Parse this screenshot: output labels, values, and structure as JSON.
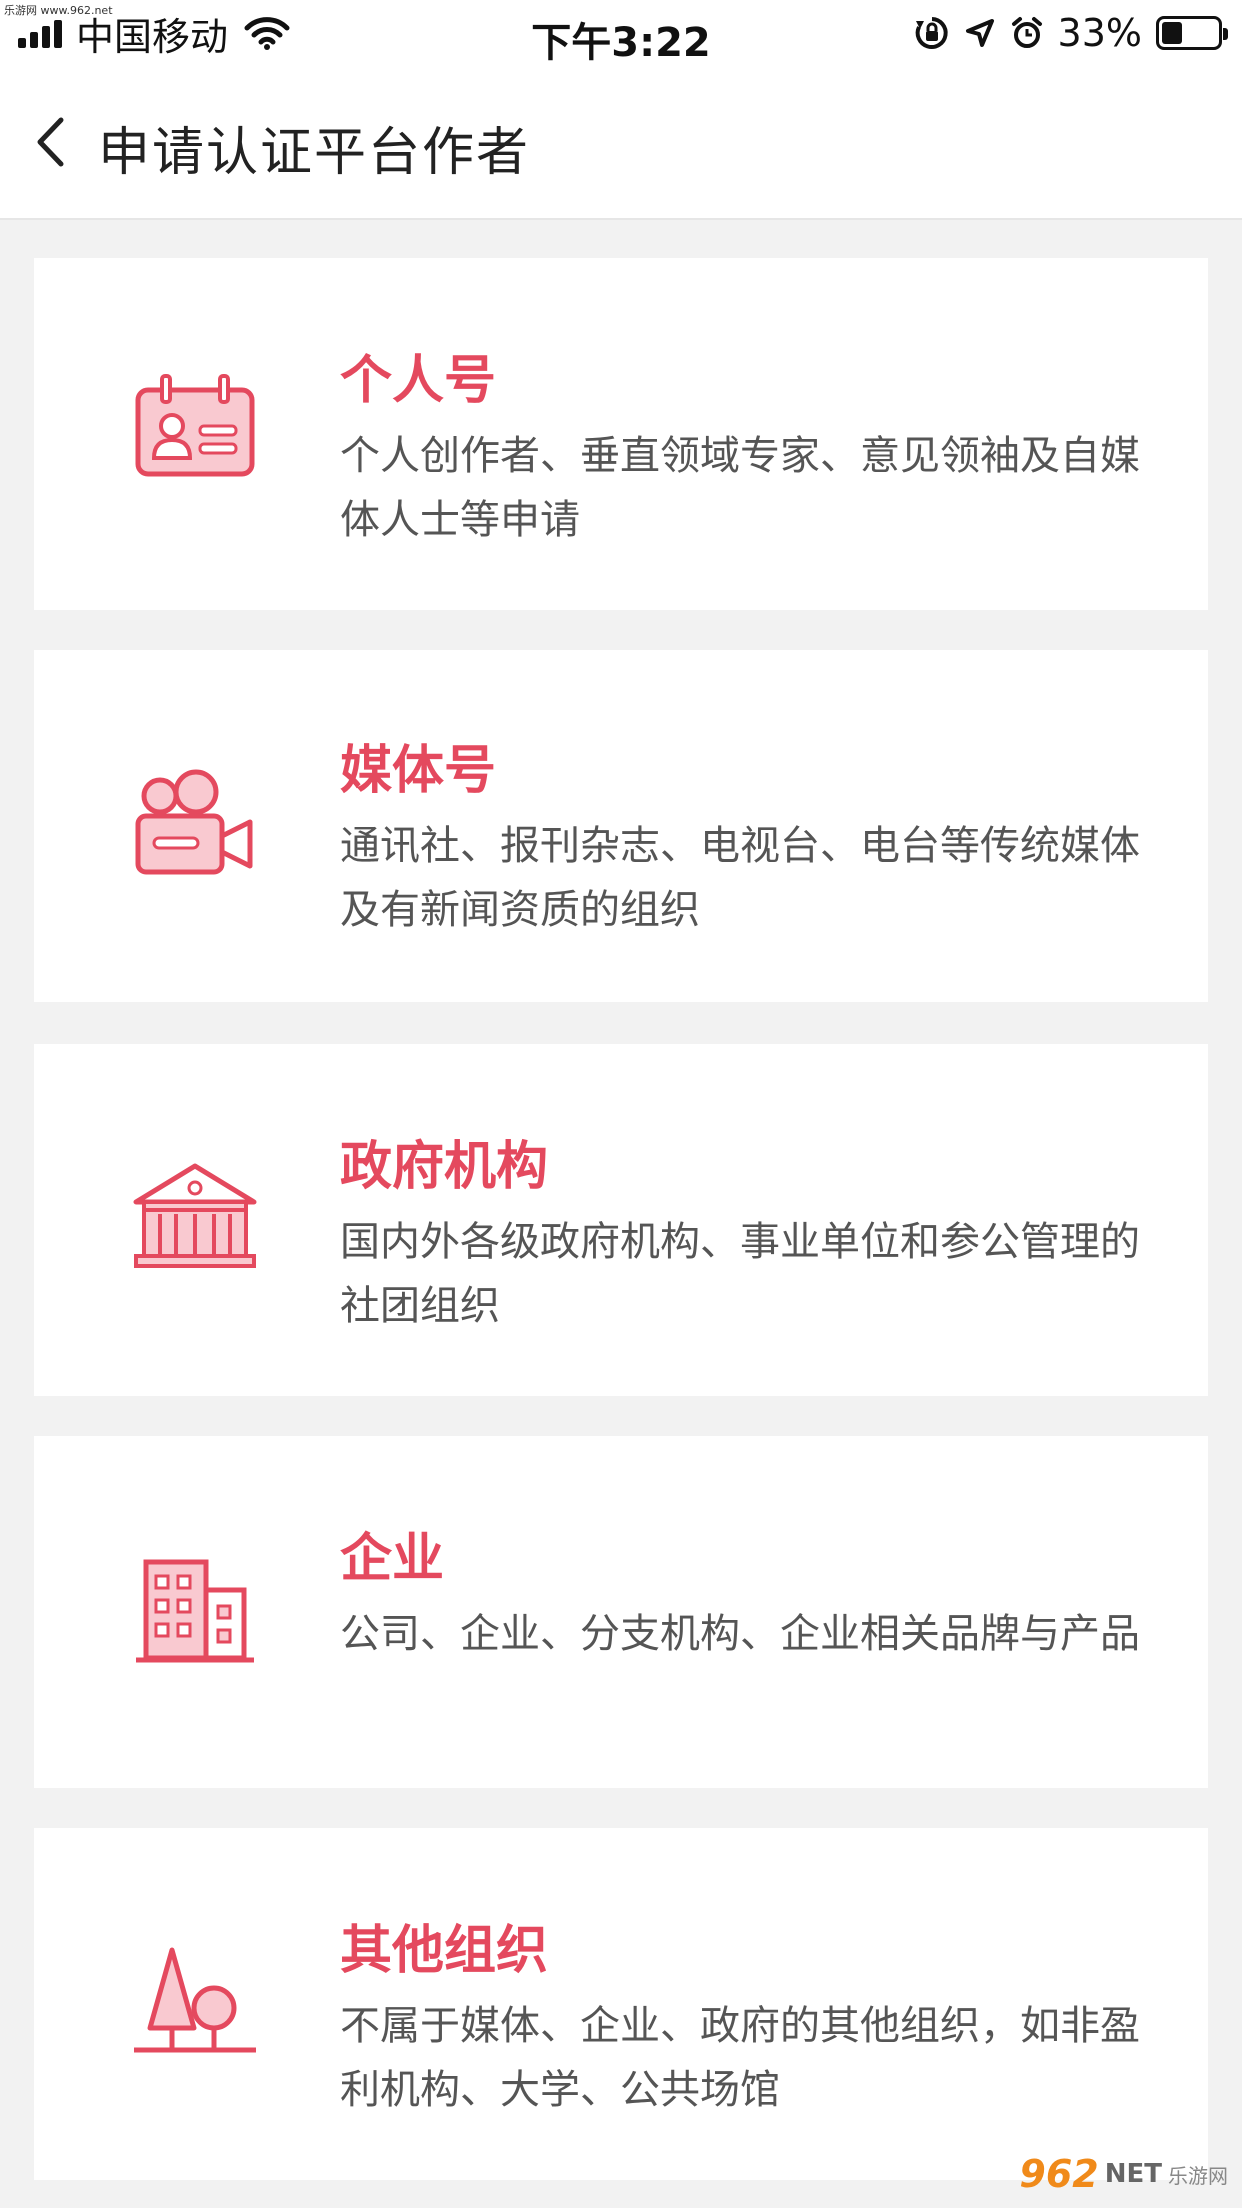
{
  "watermark_top": "乐游网 www.962.net",
  "status_bar": {
    "carrier": "中国移动",
    "time": "下午3:22",
    "battery": "33%"
  },
  "nav": {
    "title": "申请认证平台作者"
  },
  "cards": [
    {
      "title": "个人号",
      "desc": "个人创作者、垂直领域专家、意见领袖及自媒体人士等申请",
      "icon": "id-card-icon"
    },
    {
      "title": "媒体号",
      "desc": "通讯社、报刊杂志、电视台、电台等传统媒体及有新闻资质的组织",
      "icon": "video-camera-icon"
    },
    {
      "title": "政府机构",
      "desc": "国内外各级政府机构、事业单位和参公管理的社团组织",
      "icon": "government-building-icon"
    },
    {
      "title": "企业",
      "desc": "公司、企业、分支机构、企业相关品牌与产品",
      "icon": "office-building-icon"
    },
    {
      "title": "其他组织",
      "desc": "不属于媒体、企业、政府的其他组织，如非盈利机构、大学、公共场馆",
      "icon": "tree-icon"
    }
  ],
  "watermark_bottom": {
    "logo": "962",
    "net": "NET",
    "cn": "乐游网"
  },
  "colors": {
    "accent": "#e4495e",
    "icon_fill": "#f9c9d0",
    "background": "#f2f2f2"
  }
}
